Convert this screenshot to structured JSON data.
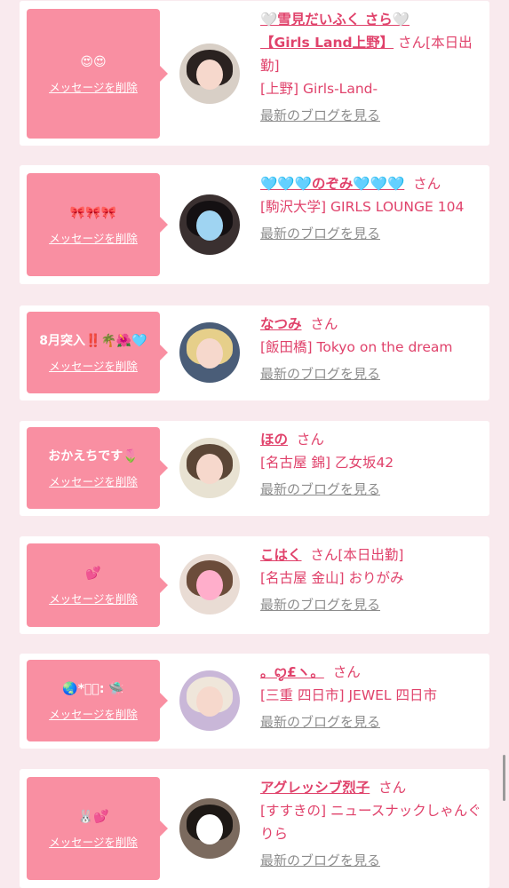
{
  "delete_label": "メッセージを削除",
  "blog_label": "最新のブログを見る",
  "san_suffix": "さん",
  "colors": {
    "accent": "#e0426b",
    "bubble": "#f98fa2",
    "background": "#f9eaee"
  },
  "cards": [
    {
      "message": "😍😍",
      "name_line1": "🤍雪見だいふく さら🤍",
      "name_line2": "【Girls Land上野】",
      "san_tail": "さん[本日出勤]",
      "shop": "[上野] Girls-Land-",
      "avatar_icon": "girl-photo"
    },
    {
      "message": "🎀🎀🎀",
      "name_line1": "🩵🩵🩵のぞみ🩵🩵🩵",
      "san_tail": "さん",
      "shop": "[駒沢大学] GIRLS LOUNGE 104",
      "avatar_icon": "girl-photo"
    },
    {
      "message": "8月突入‼️🌴🌺🩵",
      "name_line1": "なつみ",
      "san_tail": "さん",
      "shop": "[飯田橋] Tokyo on the dream",
      "avatar_icon": "girl-photo"
    },
    {
      "message": "おかえちです🌷",
      "name_line1": "ほの",
      "san_tail": "さん",
      "shop": "[名古屋 錦] 乙女坂42",
      "avatar_icon": "girl-photo"
    },
    {
      "message": "💕",
      "name_line1": "こはく",
      "san_tail": "さん[本日出勤]",
      "shop": "[名古屋 金山] おりがみ",
      "avatar_icon": "girl-photo"
    },
    {
      "message": "🌏*ﾟ･: 🛸",
      "name_line1": "。ꨄ︎£ヽ。",
      "san_tail": "さん",
      "shop": "[三重 四日市] JEWEL 四日市",
      "avatar_icon": "girl-photo"
    },
    {
      "message": "🐰💕",
      "name_line1": "アグレッシブ烈子",
      "san_tail": "さん",
      "shop": "[すすきの] ニュースナックしゃんぐりら",
      "avatar_icon": "girl-photo"
    }
  ]
}
